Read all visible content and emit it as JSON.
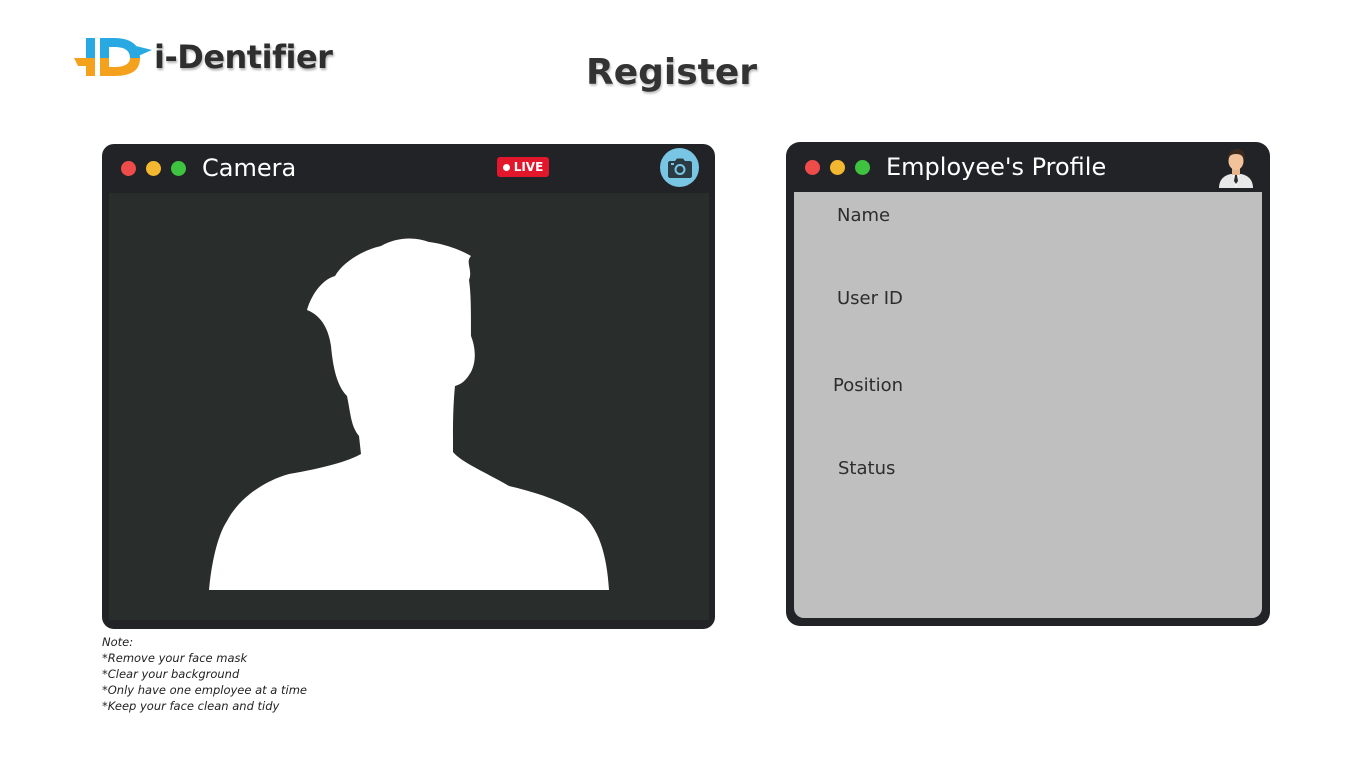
{
  "brand": {
    "name": "i-Dentifier",
    "mark_colors": {
      "blue": "#29a9e1",
      "orange": "#f4a11e"
    }
  },
  "page": {
    "title": "Register"
  },
  "camera": {
    "title": "Camera",
    "live_label": "LIVE",
    "capture_icon": "camera-icon",
    "placeholder_icon": "person-silhouette-icon"
  },
  "profile": {
    "title": "Employee's Profile",
    "avatar_icon": "employee-avatar-icon",
    "fields": [
      {
        "label": "Name"
      },
      {
        "label": "User ID"
      },
      {
        "label": "Position"
      },
      {
        "label": "Status"
      }
    ]
  },
  "notes": {
    "heading": "Note:",
    "items": [
      "*Remove your face mask",
      "*Clear your background",
      "*Only have one employee at a time",
      "*Keep your face clean and tidy"
    ]
  },
  "colors": {
    "window_frame": "#222326",
    "camera_bg": "#292d2b",
    "profile_bg": "#bfbfbf",
    "live_red": "#e3172c",
    "camera_button": "#79c5e4",
    "dot_red": "#ee4b4b",
    "dot_yellow": "#f3b730",
    "dot_green": "#3ec23f"
  }
}
